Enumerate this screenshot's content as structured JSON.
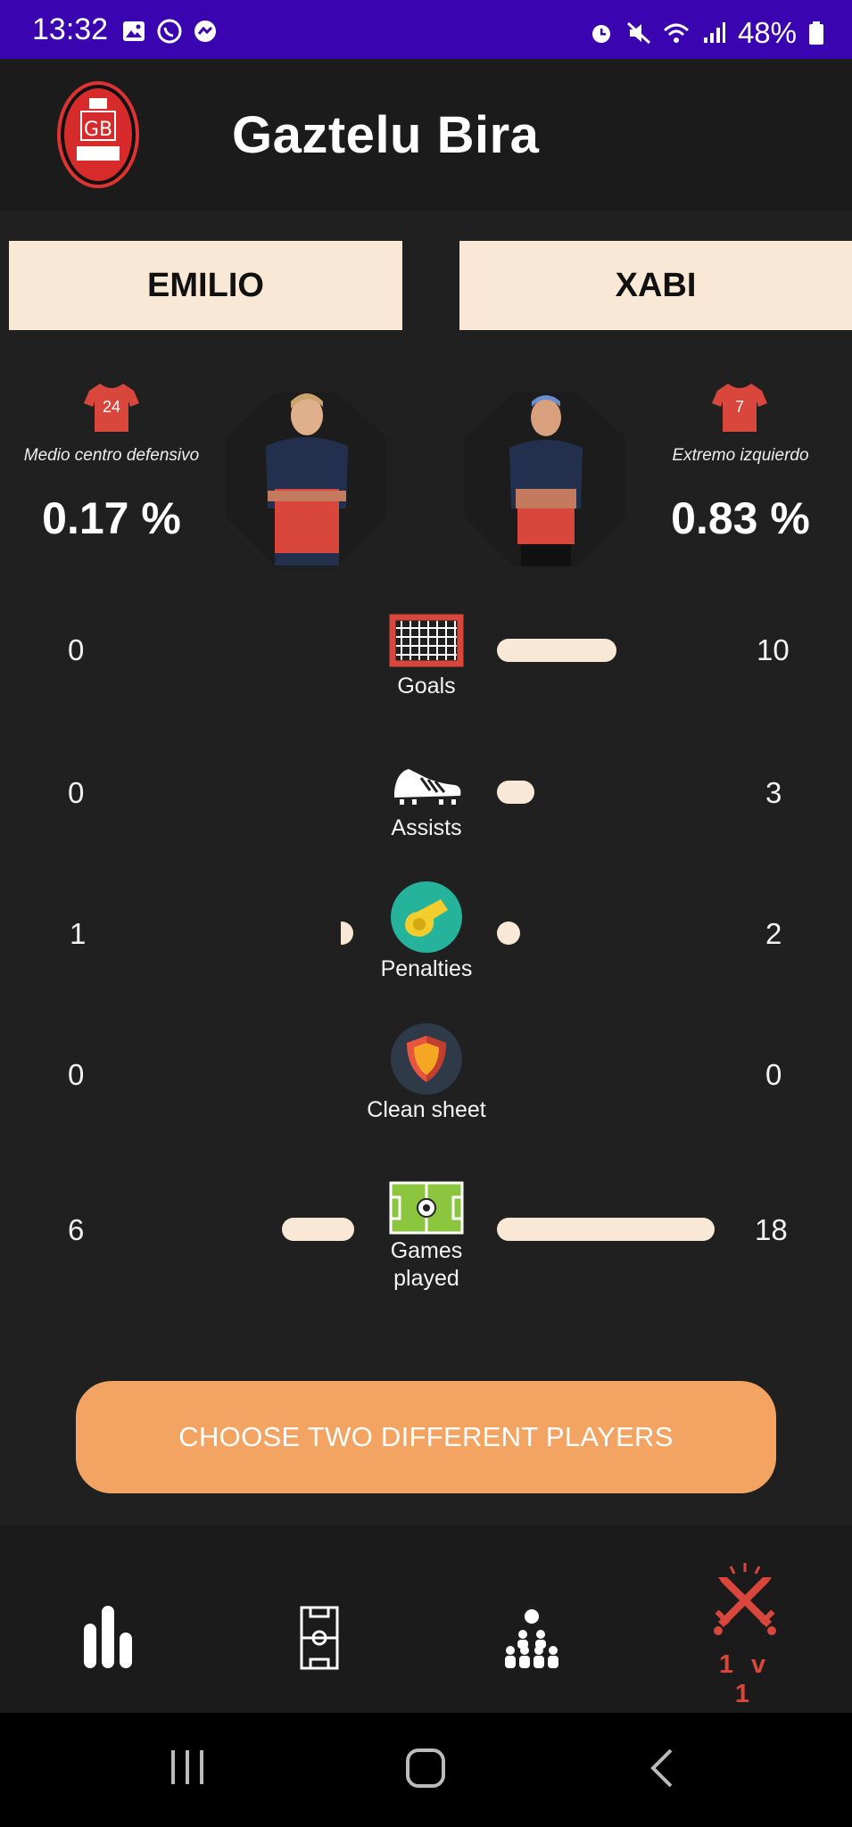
{
  "status_bar": {
    "time": "13:32",
    "battery": "48%"
  },
  "app": {
    "title": "Gaztelu Bira"
  },
  "players": {
    "left": {
      "name": "EMILIO",
      "shirt_number": "24",
      "position": "Medio centro defensivo",
      "percentage": "0.17 %"
    },
    "right": {
      "name": "XABI",
      "shirt_number": "7",
      "position": "Extremo izquierdo",
      "percentage": "0.83 %"
    }
  },
  "stats": [
    {
      "label": "Goals",
      "left": "0",
      "right": "10",
      "icon": "goal-net-icon"
    },
    {
      "label": "Assists",
      "left": "0",
      "right": "3",
      "icon": "football-boot-icon"
    },
    {
      "label": "Penalties",
      "left": "1",
      "right": "2",
      "icon": "whistle-icon"
    },
    {
      "label": "Clean sheet",
      "left": "0",
      "right": "0",
      "icon": "shield-icon"
    },
    {
      "label": "Games\nplayed",
      "left": "6",
      "right": "18",
      "icon": "pitch-icon"
    }
  ],
  "cta": {
    "label": "CHOOSE TWO DIFFERENT PLAYERS"
  },
  "bottom_nav": {
    "items": [
      "stats-icon",
      "pitch-lineup-icon",
      "team-icon",
      "versus-swords-icon"
    ],
    "active_label": "1 v 1"
  },
  "colors": {
    "accent": "#d9463b",
    "cream": "#fae8d6",
    "cta": "#f3a462",
    "status_bar": "#3a05b0"
  }
}
